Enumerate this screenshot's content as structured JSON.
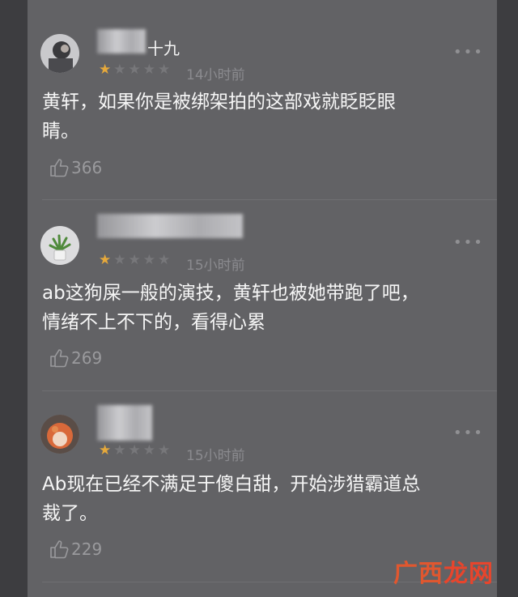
{
  "comments": [
    {
      "username": "十九",
      "rating": 1,
      "time": "14小时前",
      "text_lines": [
        "黄轩，如果你是被绑架拍的这部戏就眨眨眼",
        "睛。"
      ],
      "likes": "366"
    },
    {
      "username": "",
      "rating": 1,
      "time": "15小时前",
      "text_lines": [
        "ab这狗屎一般的演技，黄轩也被她带跑了吧，",
        "情绪不上不下的，看得心累"
      ],
      "likes": "269"
    },
    {
      "username": "",
      "rating": 1,
      "time": "15小时前",
      "text_lines": [
        "Ab现在已经不满足于傻白甜，开始涉猎霸道总",
        "裁了。"
      ],
      "likes": "229"
    }
  ],
  "more_label": "•••",
  "watermark": {
    "part1": "广西",
    "part2": "龙网"
  },
  "colors": {
    "star_on": "#e6a93b",
    "star_off": "#77777a",
    "panel": "#626265"
  },
  "icons": {
    "more": "more-options-icon",
    "like": "thumbs-up-icon",
    "star": "star-icon"
  }
}
